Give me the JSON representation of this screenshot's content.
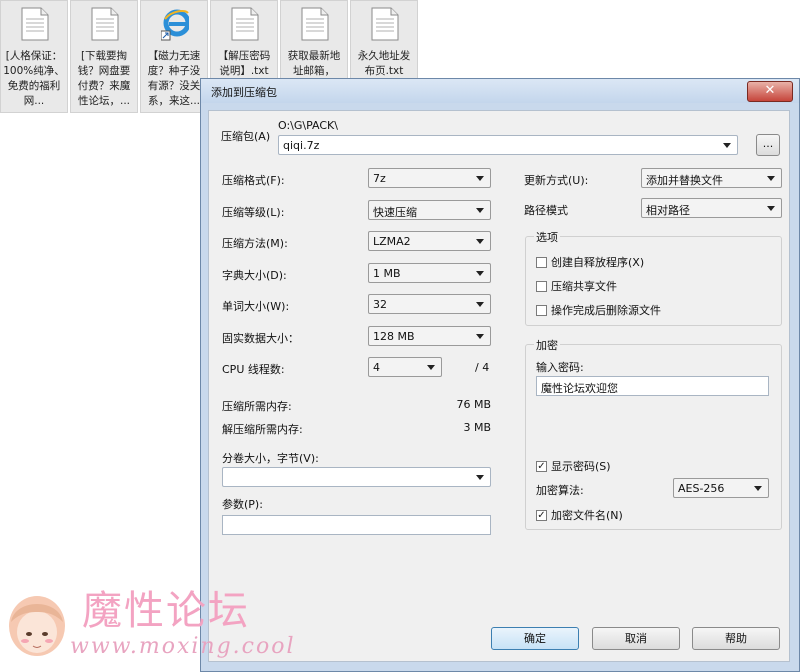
{
  "desktop": {
    "files": [
      {
        "name": "[人格保证：100%纯净、免费的福利网..."
      },
      {
        "name": "[下载要掏钱？网盘要付费？来魔性论坛，..."
      },
      {
        "name": "【磁力无速度？种子没有源？没关系，来这..."
      },
      {
        "name": "【解压密码说明】.txt"
      },
      {
        "name": "获取最新地址邮箱，无..."
      },
      {
        "name": "永久地址发布页.txt"
      }
    ]
  },
  "dialog": {
    "title": "添加到压缩包",
    "close_label": "✕",
    "archive_label": "压缩包(A)",
    "archive_path": "O:\\G\\PACK\\",
    "archive_name": "qiqi.7z",
    "browse_label": "...",
    "format_label": "压缩格式(F):",
    "format_value": "7z",
    "level_label": "压缩等级(L):",
    "level_value": "快速压缩",
    "method_label": "压缩方法(M):",
    "method_value": "LZMA2",
    "dict_label": "字典大小(D):",
    "dict_value": "1 MB",
    "word_label": "单词大小(W):",
    "word_value": "32",
    "solid_label": "固实数据大小：",
    "solid_value": "128 MB",
    "cpu_label": "CPU 线程数:",
    "cpu_value": "4",
    "cpu_total": "/ 4",
    "mem_comp_label": "压缩所需内存:",
    "mem_comp_value": "76 MB",
    "mem_decomp_label": "解压缩所需内存:",
    "mem_decomp_value": "3 MB",
    "volume_label": "分卷大小，字节(V):",
    "volume_value": "",
    "params_label": "参数(P):",
    "params_value": "",
    "update_label": "更新方式(U):",
    "update_value": "添加并替换文件",
    "path_label": "路径模式",
    "path_value": "相对路径",
    "options_title": "选项",
    "opt_sfx": "创建自释放程序(X)",
    "opt_shared": "压缩共享文件",
    "opt_delete": "操作完成后删除源文件",
    "encrypt_title": "加密",
    "password_label": "输入密码:",
    "password_value": "魔性论坛欢迎您",
    "show_password": "显示密码(S)",
    "enc_method_label": "加密算法:",
    "enc_method_value": "AES-256",
    "encrypt_names": "加密文件名(N)",
    "check_mark": "✓",
    "ok_label": "确定",
    "cancel_label": "取消",
    "help_label": "帮助"
  },
  "watermark": {
    "text": "魔性论坛",
    "url": "www.moxing.cool"
  },
  "colors": {
    "dialog_frame": "#c9d9ec",
    "panel": "#f0f0f0",
    "watermark_pink": "#f3a3c2"
  }
}
